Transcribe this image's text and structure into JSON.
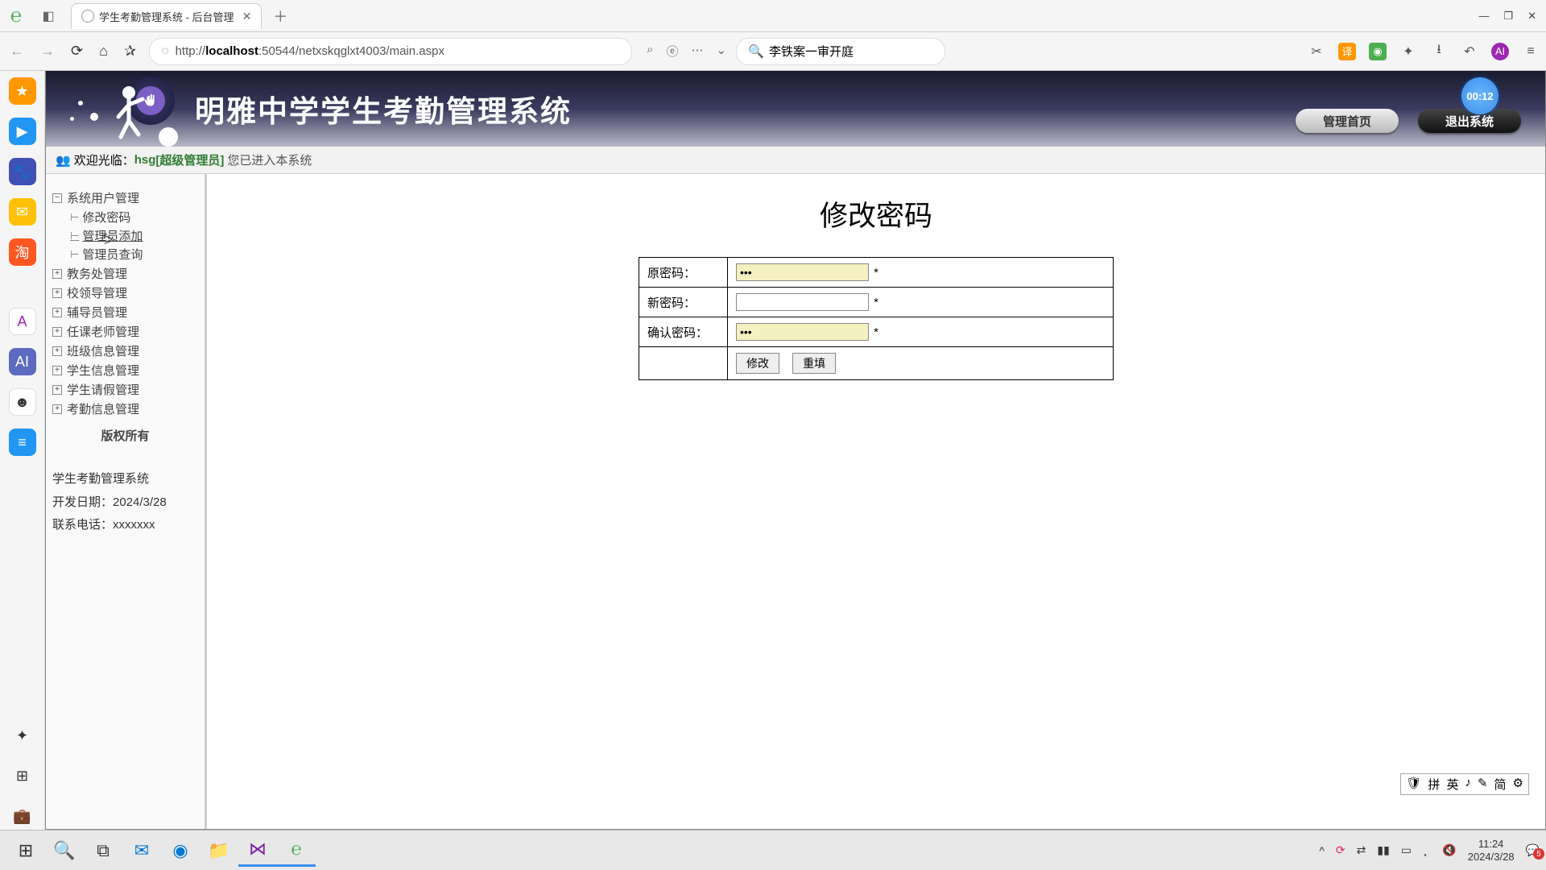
{
  "browser": {
    "tab_title": "学生考勤管理系统 - 后台管理",
    "url_prefix": "http://",
    "url_bold": "localhost",
    "url_rest": ":50544/netxskqglxt4003/main.aspx",
    "search_value": "李铁案一审开庭"
  },
  "header": {
    "title": "明雅中学学生考勤管理系统",
    "home_btn": "管理首页",
    "exit_btn": "退出系统"
  },
  "welcome": {
    "prefix": "欢迎光临：",
    "user": "hsg",
    "role": "[超级管理员]",
    "suffix": "您已进入本系统"
  },
  "timer": "00:12",
  "sidebar": {
    "nodes": [
      {
        "label": "系统用户管理",
        "expanded": true,
        "children": [
          "修改密码",
          "管理员添加",
          "管理员查询"
        ],
        "active_child": 1
      },
      {
        "label": "教务处管理"
      },
      {
        "label": "校领导管理"
      },
      {
        "label": "辅导员管理"
      },
      {
        "label": "任课老师管理"
      },
      {
        "label": "班级信息管理"
      },
      {
        "label": "学生信息管理"
      },
      {
        "label": "学生请假管理"
      },
      {
        "label": "考勤信息管理"
      }
    ],
    "copyright": "版权所有",
    "sys_name": "学生考勤管理系统",
    "dev_date_label": "开发日期：",
    "dev_date": "2024/3/28",
    "contact_label": "联系电话：",
    "contact": "xxxxxxx"
  },
  "content": {
    "title": "修改密码",
    "rows": {
      "old_pw_label": "原密码：",
      "new_pw_label": "新密码：",
      "confirm_pw_label": "确认密码：",
      "old_pw_value": "•••",
      "new_pw_value": "",
      "confirm_pw_value": "•••",
      "required": "*",
      "submit": "修改",
      "reset": "重填"
    }
  },
  "ime": {
    "items": [
      "拼",
      "英",
      "♪",
      "✎",
      "简"
    ]
  },
  "taskbar": {
    "time": "11:24",
    "date": "2024/3/28",
    "notif_count": "5"
  }
}
